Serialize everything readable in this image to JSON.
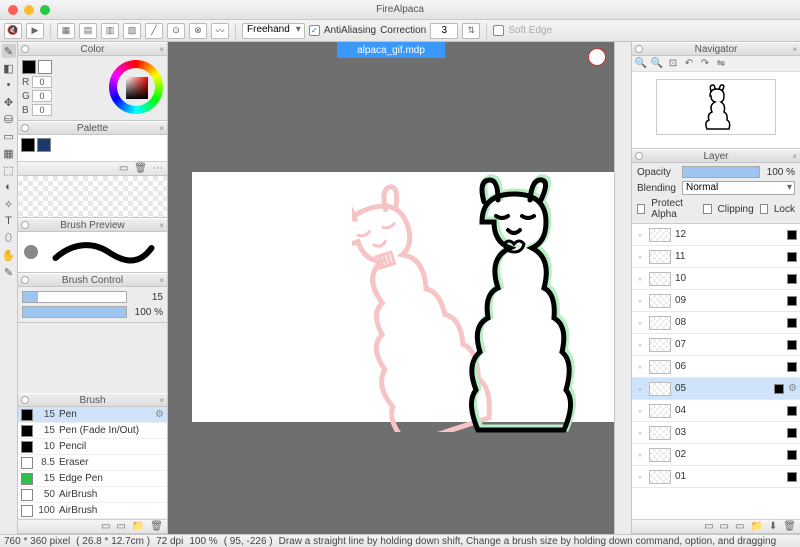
{
  "app": {
    "title": "FireAlpaca"
  },
  "toolbar": {
    "mode": "Freehand",
    "aa_label": "AntiAliasing",
    "aa_checked": true,
    "correction_label": "Correction",
    "correction_value": "3",
    "softedge_label": "Soft Edge",
    "softedge_checked": false
  },
  "file_tab": "alpaca_gif.mdp",
  "panels": {
    "color": {
      "title": "Color",
      "r": "0",
      "g": "0",
      "b": "0"
    },
    "palette": {
      "title": "Palette",
      "swatches": [
        "#000000",
        "#1b3a6b"
      ]
    },
    "brush_preview": {
      "title": "Brush Preview"
    },
    "brush_control": {
      "title": "Brush Control",
      "size": "15",
      "opacity": "100 %"
    },
    "brush": {
      "title": "Brush",
      "items": [
        {
          "size": "15",
          "name": "Pen",
          "color": "#000",
          "sel": true
        },
        {
          "size": "15",
          "name": "Pen (Fade In/Out)",
          "color": "#000"
        },
        {
          "size": "10",
          "name": "Pencil",
          "color": "#000"
        },
        {
          "size": "8.5",
          "name": "Eraser",
          "color": "#fff"
        },
        {
          "size": "15",
          "name": "Edge Pen",
          "color": "#2bc24a"
        },
        {
          "size": "50",
          "name": "AirBrush",
          "color": "#fff"
        },
        {
          "size": "100",
          "name": "AirBrush",
          "color": "#fff"
        }
      ]
    },
    "navigator": {
      "title": "Navigator"
    },
    "layer": {
      "title": "Layer",
      "opacity_label": "Opacity",
      "opacity_value": "100 %",
      "blending_label": "Blending",
      "blending_value": "Normal",
      "protect_label": "Protect Alpha",
      "clipping_label": "Clipping",
      "lock_label": "Lock",
      "items": [
        {
          "name": "12"
        },
        {
          "name": "11"
        },
        {
          "name": "10"
        },
        {
          "name": "09"
        },
        {
          "name": "08"
        },
        {
          "name": "07"
        },
        {
          "name": "06"
        },
        {
          "name": "05",
          "sel": true
        },
        {
          "name": "04"
        },
        {
          "name": "03"
        },
        {
          "name": "02"
        },
        {
          "name": "01"
        }
      ]
    }
  },
  "status": {
    "dims": "760 * 360 pixel",
    "cm": "( 26.8 * 12.7cm )",
    "dpi": "72 dpi",
    "zoom": "100 %",
    "coords": "( 95, -226 )",
    "hint": "Draw a straight line by holding down shift, Change a brush size by holding down command, option, and dragging"
  }
}
